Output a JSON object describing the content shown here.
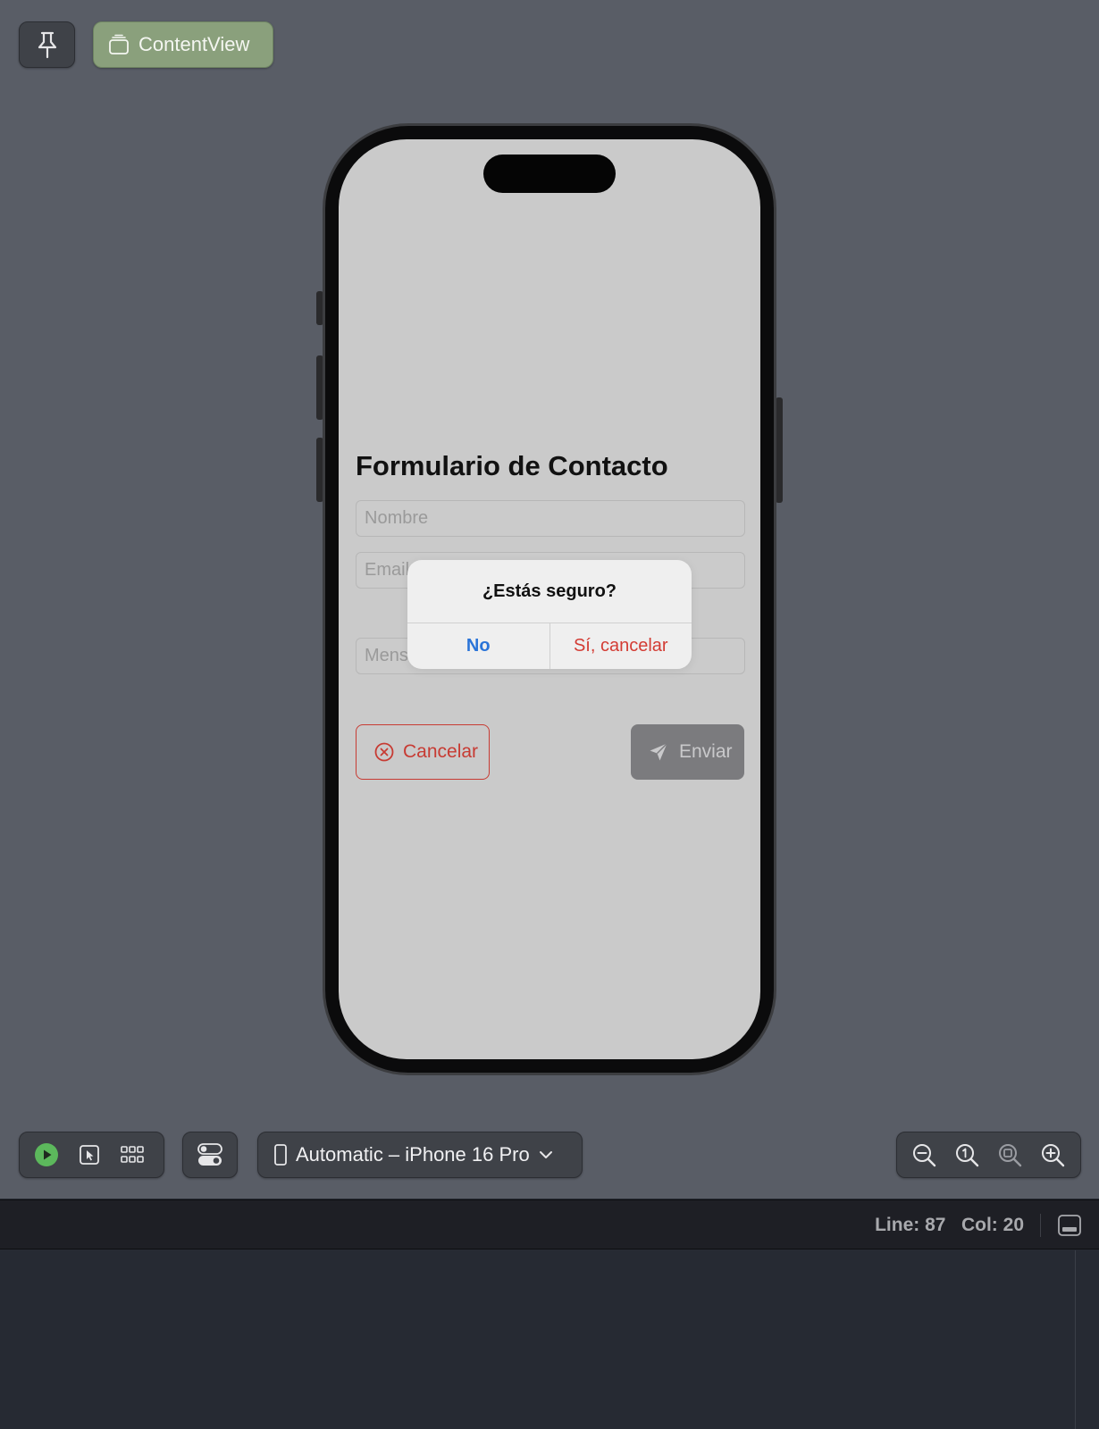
{
  "top_bar": {
    "pin_icon": "pin-icon",
    "content_view": {
      "icon": "stack-icon",
      "label": "ContentView"
    }
  },
  "app": {
    "title": "Formulario de Contacto",
    "fields": [
      {
        "placeholder": "Nombre"
      },
      {
        "placeholder": "Email"
      },
      {
        "placeholder": "Mensa"
      }
    ],
    "cancel_button": {
      "icon": "x-circle-icon",
      "label": "Cancelar",
      "color": "#c73b33"
    },
    "send_button": {
      "icon": "paper-plane-icon",
      "label": "Enviar"
    }
  },
  "alert": {
    "title": "¿Estás seguro?",
    "no_label": "No",
    "yes_label": "Sí, cancelar",
    "no_color": "#2a74d8",
    "yes_color": "#d33c34"
  },
  "toolbar": {
    "live_icon": "play-icon",
    "select_icon": "cursor-icon",
    "variants_icon": "grid-icon",
    "settings_icon": "toggle-icon",
    "device": {
      "icon": "iphone-icon",
      "label": "Automatic – iPhone 16 Pro",
      "chevron": "chevron-down-icon"
    },
    "zoom": [
      "zoom-out-icon",
      "zoom-100-icon",
      "zoom-fit-icon",
      "zoom-in-icon"
    ]
  },
  "status": {
    "line": "Line: 87",
    "col": "Col: 20"
  }
}
